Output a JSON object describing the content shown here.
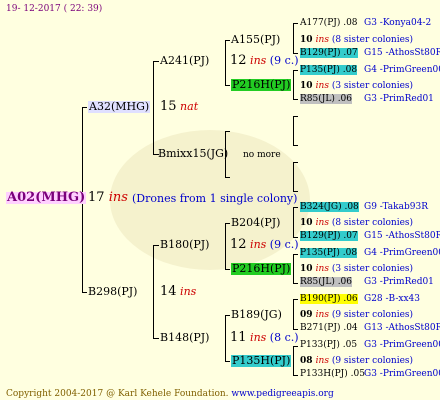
{
  "header": {
    "date": "19- 12-2017 ( 22: 39)"
  },
  "footer": {
    "copyright": "Copyright 2004-2017 @ Karl Kehele Foundation.",
    "site": "www.pedigreeapis.org"
  },
  "root": {
    "name": "A02(MHG)",
    "count": "17",
    "ins": "ins",
    "note": "(Drones from 1 single colony)"
  },
  "gen1": [
    {
      "name": "A32(MHG)",
      "count": "15",
      "suffix": "nat"
    },
    {
      "name": "B298(PJ)",
      "count": "14",
      "suffix": "ins"
    }
  ],
  "gen2": [
    {
      "name": "A241(PJ)",
      "count": "12",
      "suffix": "ins",
      "note": "(9 c.)"
    },
    {
      "name": "Bmixx15(JG)",
      "count": "",
      "suffix": "",
      "note": "no more"
    },
    {
      "name": "B180(PJ)",
      "count": "12",
      "suffix": "ins",
      "note": "(9 c.)"
    },
    {
      "name": "B148(PJ)",
      "count": "11",
      "suffix": "ins",
      "note": "(8 c.)"
    }
  ],
  "gen3": [
    {
      "name": "A155(PJ)"
    },
    {
      "name": "P216H(PJ)"
    },
    {
      "name": "B204(PJ)"
    },
    {
      "name": "P216H(PJ)"
    },
    {
      "name": "B189(JG)"
    },
    {
      "name": "P135H(PJ)"
    }
  ],
  "gen4": [
    {
      "name": "A177(PJ)",
      "num": ".08",
      "loc": "G3 -Konya04-2"
    },
    {
      "count": "10",
      "ins": "ins",
      "note": "(8 sister colonies)"
    },
    {
      "name": "B129(PJ)",
      "num": ".07",
      "loc": "G15 -AthosSt80R"
    },
    {
      "name": "P135(PJ)",
      "num": ".08",
      "loc": "G4 -PrimGreen00"
    },
    {
      "count": "10",
      "ins": "ins",
      "note": "(3 sister colonies)"
    },
    {
      "name": "R85(JL)",
      "num": ".06",
      "loc": "G3 -PrimRed01"
    },
    {
      "name": "B324(JG)",
      "num": ".08",
      "loc": "G9 -Takab93R"
    },
    {
      "count": "10",
      "ins": "ins",
      "note": "(8 sister colonies)"
    },
    {
      "name": "B129(PJ)",
      "num": ".07",
      "loc": "G15 -AthosSt80R"
    },
    {
      "name": "P135(PJ)",
      "num": ".08",
      "loc": "G4 -PrimGreen00"
    },
    {
      "count": "10",
      "ins": "ins",
      "note": "(3 sister colonies)"
    },
    {
      "name": "R85(JL)",
      "num": ".06",
      "loc": "G3 -PrimRed01"
    },
    {
      "name": "B190(PJ)",
      "num": ".06",
      "loc": "G28 -B-xx43"
    },
    {
      "count": "09",
      "ins": "ins",
      "note": "(9 sister colonies)"
    },
    {
      "name": "B271(PJ)",
      "num": ".04",
      "loc": "G13 -AthosSt80R"
    },
    {
      "name": "P133(PJ)",
      "num": ".05",
      "loc": "G3 -PrimGreen00"
    },
    {
      "count": "08",
      "ins": "ins",
      "note": "(9 sister colonies)"
    },
    {
      "name": "P133H(PJ)",
      "num": ".05",
      "loc": "G3 -PrimGreen00"
    }
  ]
}
